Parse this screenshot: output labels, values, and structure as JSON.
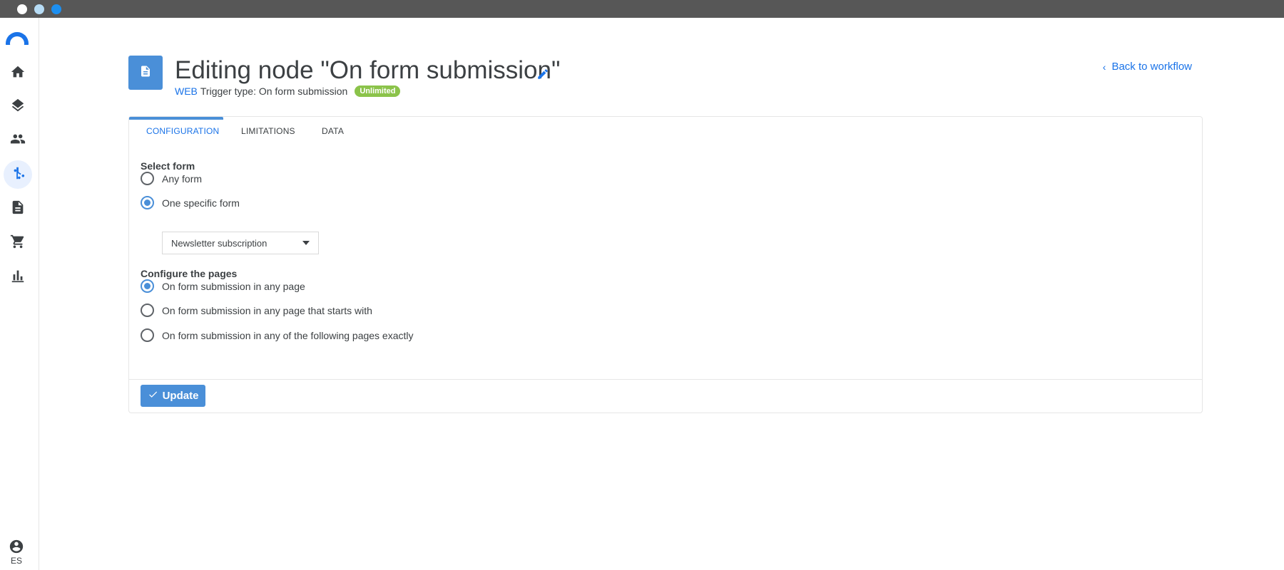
{
  "window": {
    "buttons": [
      "close",
      "minimize",
      "maximize"
    ]
  },
  "sidebar": {
    "logo_icon": "brand-arc-icon",
    "items": [
      {
        "icon": "home-icon",
        "active": false
      },
      {
        "icon": "layers-icon",
        "active": false
      },
      {
        "icon": "people-icon",
        "active": false
      },
      {
        "icon": "workflow-icon",
        "active": true
      },
      {
        "icon": "document-icon",
        "active": false
      },
      {
        "icon": "cart-icon",
        "active": false
      },
      {
        "icon": "bar-chart-icon",
        "active": false
      }
    ],
    "user_icon": "account-circle-icon",
    "language": "ES"
  },
  "header": {
    "node_icon": "document-icon",
    "title": "Editing node \"On form submission\"",
    "edit_icon": "pencil-icon",
    "channel": "WEB",
    "trigger_type": "Trigger type: On form submission",
    "badge": "Unlimited",
    "back_link": "Back to workflow"
  },
  "tabs": [
    {
      "label": "CONFIGURATION",
      "active": true
    },
    {
      "label": "LIMITATIONS",
      "active": false
    },
    {
      "label": "DATA",
      "active": false
    }
  ],
  "select_form": {
    "label": "Select form",
    "options": [
      {
        "label": "Any form",
        "checked": false
      },
      {
        "label": "One specific form",
        "checked": true
      }
    ],
    "dropdown_value": "Newsletter subscription"
  },
  "pages": {
    "label": "Configure the pages",
    "options": [
      {
        "label": "On form submission in any page",
        "checked": true
      },
      {
        "label": "On form submission in any page that starts with",
        "checked": false
      },
      {
        "label": "On form submission in any of the following pages exactly",
        "checked": false
      }
    ]
  },
  "actions": {
    "update_label": "Update",
    "update_icon": "check-icon"
  },
  "colors": {
    "accent": "#4a8fd8",
    "link": "#1a73e8",
    "badge": "#8bc34a",
    "titlebar": "#575757"
  }
}
